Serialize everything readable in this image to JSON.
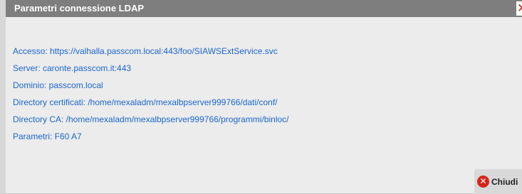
{
  "window": {
    "title": "Parametri connessione LDAP",
    "close_icon": "close-x-icon"
  },
  "info": {
    "lines": [
      "Accesso: https://valhalla.passcom.local:443/foo/SIAWSExtService.svc",
      "Server: caronte.passcom.it:443",
      "Dominio: passcom.local",
      "Directory certificati: /home/mexaladm/mexalbpserver999766/dati/conf/",
      "Directory CA: /home/mexaladm/mexalbpserver999766/programmi/binloc/",
      "Parametri: F60 A7"
    ]
  },
  "footer": {
    "close_label": "Chiudi",
    "close_icon": "close-circle-icon"
  },
  "colors": {
    "titlebar": "#7e7e7e",
    "text": "#1a66cc",
    "accent_red": "#d4261c"
  }
}
